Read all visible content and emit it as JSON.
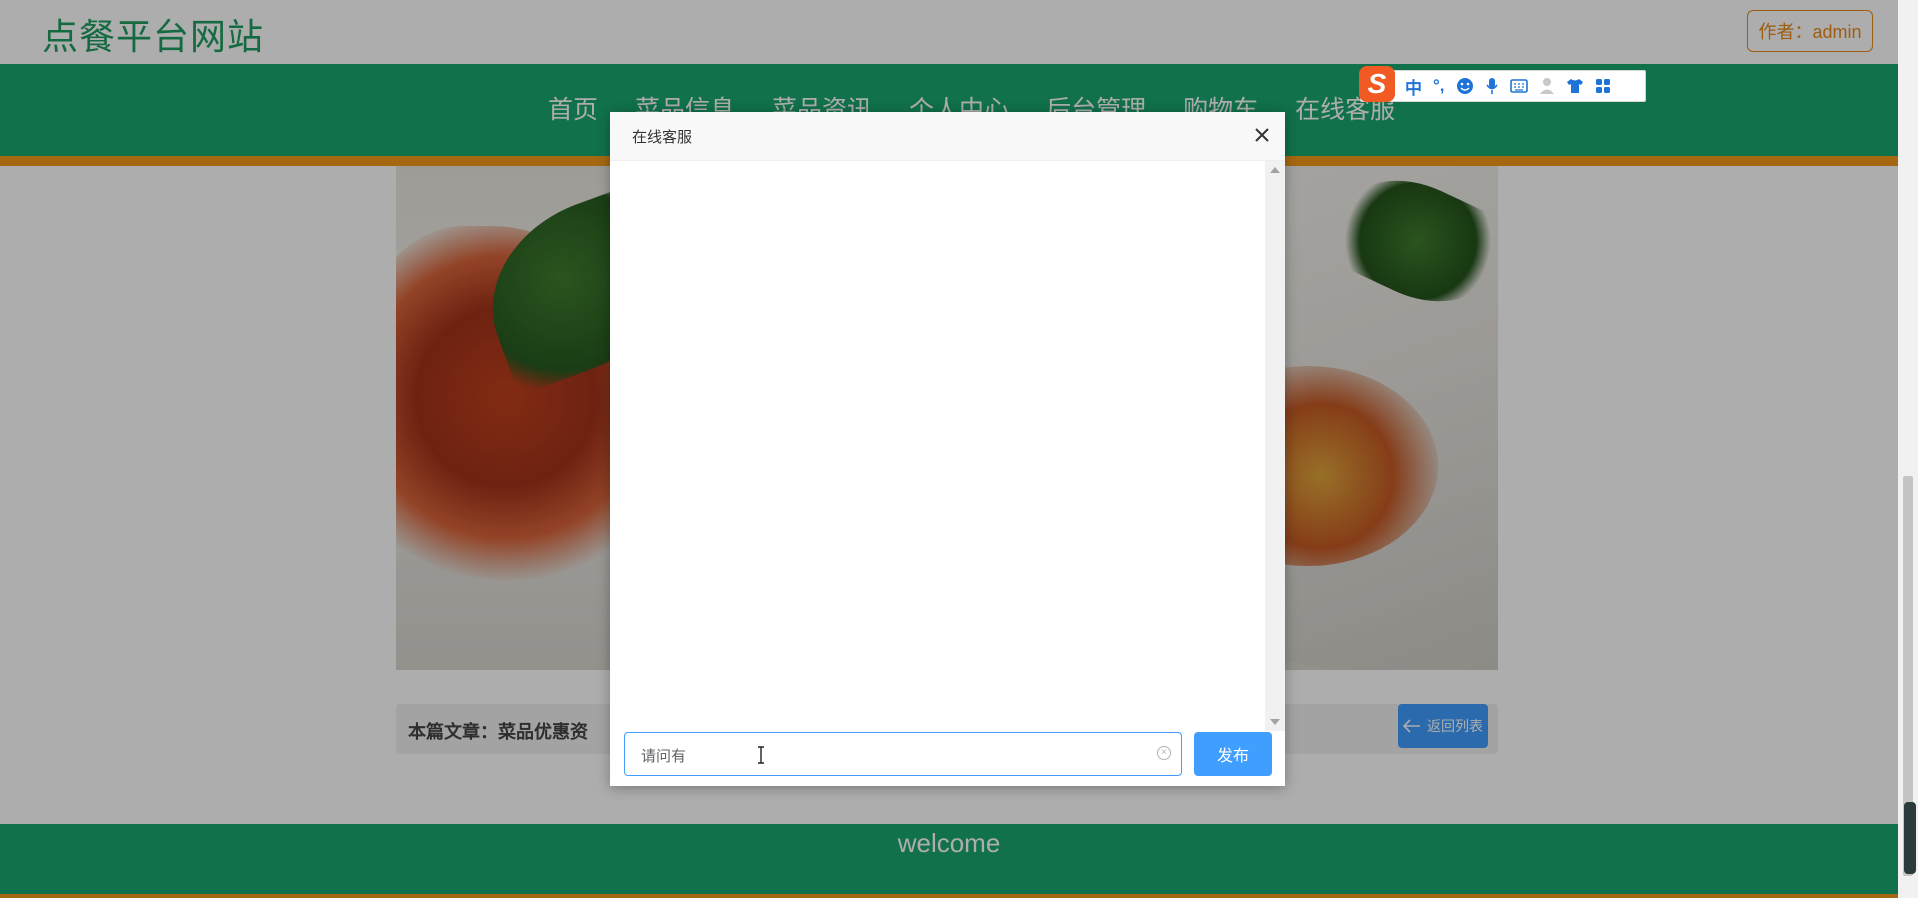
{
  "header": {
    "site_title": "点餐平台网站",
    "author_label": "作者：admin"
  },
  "nav": {
    "items": [
      "首页",
      "菜品信息",
      "菜品资讯",
      "个人中心",
      "后台管理",
      "购物车",
      "在线客服"
    ]
  },
  "article": {
    "label": "本篇文章：菜品优惠资",
    "back_label": "返回列表"
  },
  "footer": {
    "text": "welcome"
  },
  "ime": {
    "logo": "S",
    "mode_label": "中",
    "punct_label": "°,"
  },
  "dialog": {
    "title": "在线客服",
    "input_value": "请问有",
    "publish_label": "发布"
  },
  "colors": {
    "brand_green": "#18a76d",
    "accent_orange": "#f39a1a",
    "primary_blue": "#409eff"
  }
}
